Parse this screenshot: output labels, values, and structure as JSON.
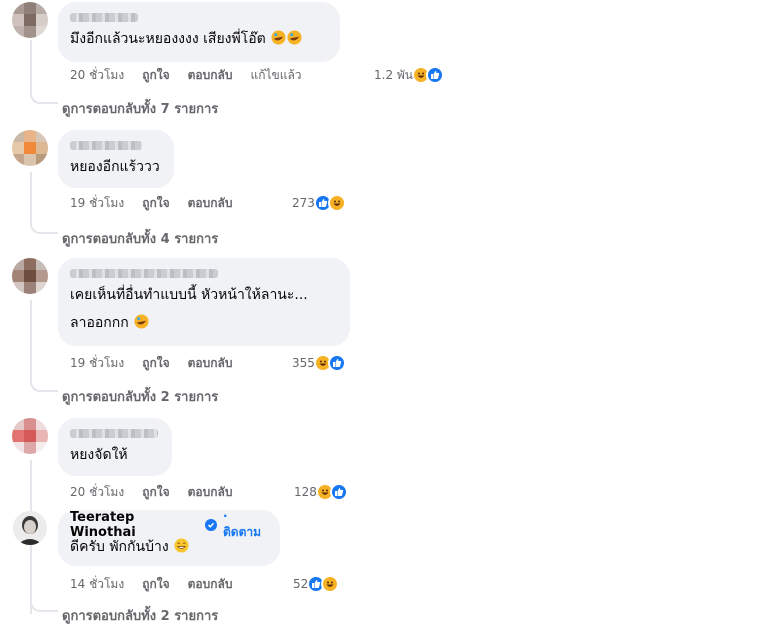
{
  "comments": [
    {
      "text": "มึงอีกแล้วนะหยองงงง เสียงพี่โอ๊ต",
      "time": "20 ชั่วโมง",
      "like": "ถูกใจ",
      "reply": "ตอบกลับ",
      "edited": "แก้ไขแล้ว",
      "reactions": "1.2 พัน",
      "view_replies": "ดูการตอบกลับทั้ง 7 รายการ"
    },
    {
      "text": "หยองอีกแร้ววว",
      "time": "19 ชั่วโมง",
      "like": "ถูกใจ",
      "reply": "ตอบกลับ",
      "reactions": "273",
      "view_replies": "ดูการตอบกลับทั้ง 4 รายการ"
    },
    {
      "text": "เคยเห็นที่อื่นทำแบบนี้ หัวหน้าให้ลานะ...",
      "text2": "ลาออกกก",
      "time": "19 ชั่วโมง",
      "like": "ถูกใจ",
      "reply": "ตอบกลับ",
      "reactions": "355",
      "view_replies": "ดูการตอบกลับทั้ง 2 รายการ"
    },
    {
      "text": "หยงจัดให้",
      "time": "20 ชั่วโมง",
      "like": "ถูกใจ",
      "reply": "ตอบกลับ",
      "reactions": "128"
    },
    {
      "author": "Teeratep Winothai",
      "follow": "· ติดตาม",
      "text": "ดีครับ พักกันบ้าง",
      "time": "14 ชั่วโมง",
      "like": "ถูกใจ",
      "reply": "ตอบกลับ",
      "reactions": "52",
      "view_replies": "ดูการตอบกลับทั้ง 2 รายการ"
    }
  ],
  "icons": {
    "like": "like-reaction-icon",
    "haha": "haha-reaction-icon",
    "rofl": "rolling-laughing-emoji",
    "grin": "grinning-sweat-emoji",
    "verified": "verified-badge-icon"
  },
  "colors": {
    "bubble": "#f0f2f5",
    "meta": "#65676b",
    "link": "#1877f2"
  }
}
